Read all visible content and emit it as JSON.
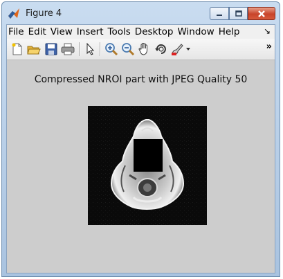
{
  "window": {
    "title": "Figure 4"
  },
  "menubar": {
    "items": [
      "File",
      "Edit",
      "View",
      "Insert",
      "Tools",
      "Desktop",
      "Window",
      "Help"
    ],
    "overflow": "↘"
  },
  "toolbar": {
    "buttons": [
      "new-figure-icon",
      "open-file-icon",
      "save-icon",
      "print-icon",
      "edit-plot-arrow-icon",
      "zoom-in-icon",
      "zoom-out-icon",
      "pan-hand-icon",
      "rotate-3d-icon",
      "data-cursor-brush-icon"
    ],
    "overflow": "»"
  },
  "figure": {
    "title": "Compressed NROI part with JPEG Quality 50"
  },
  "colors": {
    "figure_bg": "#cdcdcd",
    "title_bar": "#b9d1ea",
    "close_button": "#c8442a"
  }
}
